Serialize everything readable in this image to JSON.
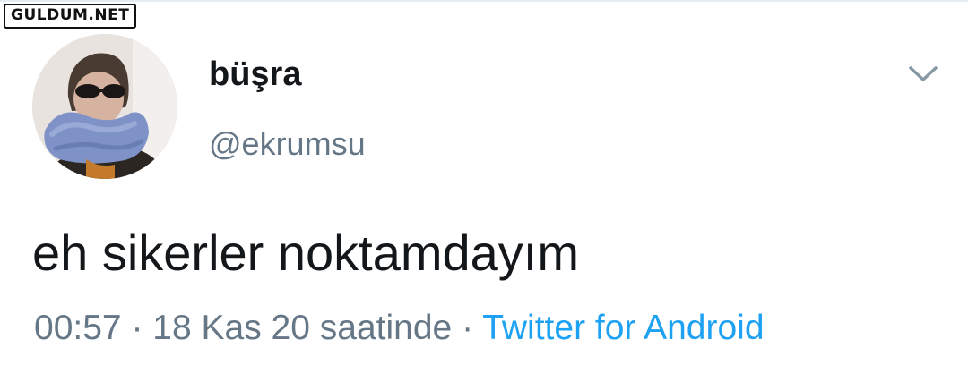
{
  "watermark": {
    "text": "GULDUM.NET"
  },
  "author": {
    "display_name": "büşra",
    "handle": "@ekrumsu",
    "avatar_icon": "profile-photo"
  },
  "tweet": {
    "text": "eh sikerler noktamdayım"
  },
  "meta": {
    "time": "00:57",
    "separator": "·",
    "date": "18 Kas 20 saatinde",
    "source": "Twitter for Android"
  },
  "colors": {
    "primary_text": "#14171a",
    "secondary_text": "#657786",
    "link": "#1da1f2",
    "divider": "#e6ecf0"
  },
  "icons": {
    "menu": "chevron-down-icon"
  }
}
